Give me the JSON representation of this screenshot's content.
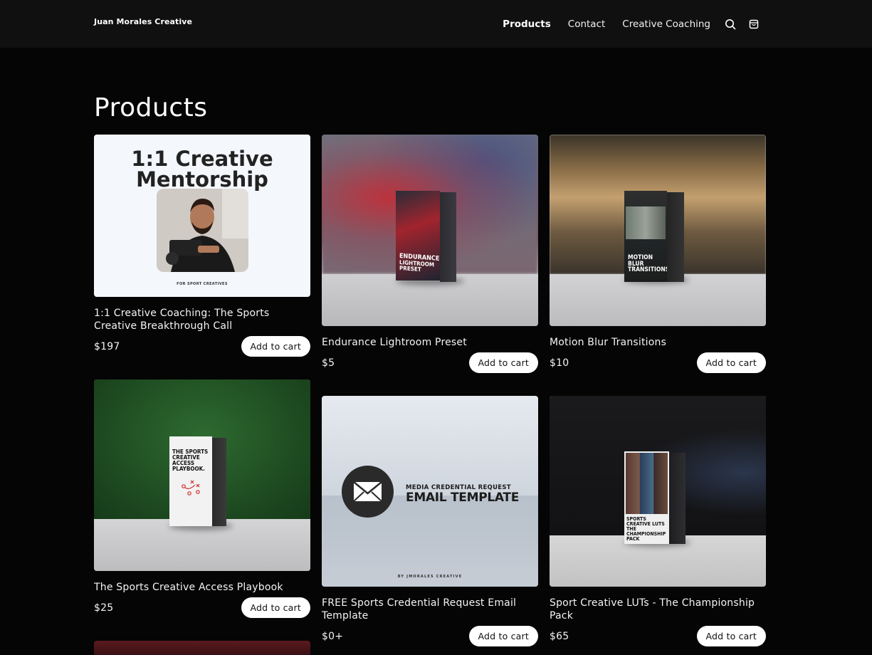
{
  "header": {
    "brand": "Juan Morales Creative",
    "nav": [
      {
        "label": "Products",
        "active": true
      },
      {
        "label": "Contact",
        "active": false
      },
      {
        "label": "Creative Coaching",
        "active": false
      }
    ],
    "icons": [
      "search-icon",
      "cart-icon"
    ]
  },
  "main": {
    "title": "Products",
    "add_to_cart_label": "Add to cart",
    "products": [
      {
        "title": "1:1 Creative Coaching: The Sports Creative Breakthrough Call",
        "price": "$197",
        "image": {
          "heading_line1": "1:1 Creative",
          "heading_line2": "Mentorship",
          "footer": "FOR SPORT CREATIVES"
        }
      },
      {
        "title": "Endurance Lightroom Preset",
        "price": "$5",
        "image": {
          "box_text_line1": "ENDURANCE",
          "box_text_line2": "LIGHTROOM PRESET"
        }
      },
      {
        "title": "Motion Blur Transitions",
        "price": "$10",
        "image": {
          "box_text_line1": "MOTION BLUR",
          "box_text_line2": "TRANSITIONS"
        }
      },
      {
        "title": "The Sports Creative Access Playbook",
        "price": "$25",
        "image": {
          "box_text_line1": "THE SPORTS",
          "box_text_line2": "CREATIVE ACCESS",
          "box_text_line3": "PLAYBOOK."
        }
      },
      {
        "title": "FREE Sports Credential Request Email Template",
        "price": "$0+",
        "image": {
          "subheading": "MEDIA CREDENTIAL REQUEST",
          "heading": "EMAIL TEMPLATE",
          "footer": "BY JMORALES CREATIVE"
        }
      },
      {
        "title": "Sport Creative LUTs - The Championship Pack",
        "price": "$65",
        "image": {
          "box_text_line1": "SPORTS CREATIVE LUTS",
          "box_text_line2": "THE CHAMPIONSHIP PACK"
        }
      }
    ]
  },
  "colors": {
    "background": "#050505",
    "header_bg": "#101010",
    "button_bg": "#ffffff",
    "text": "#f4f4f4"
  }
}
